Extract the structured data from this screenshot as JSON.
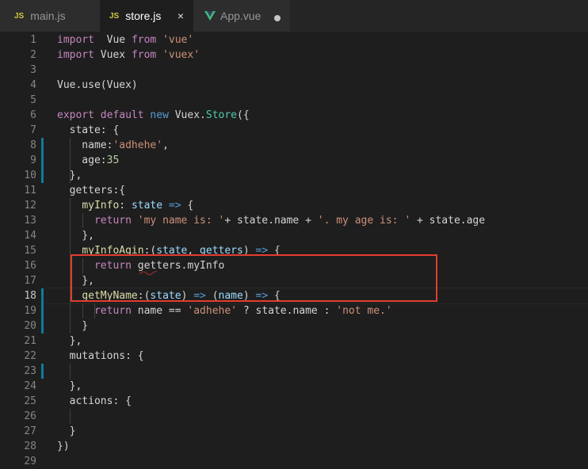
{
  "tabs": [
    {
      "label": "main.js",
      "icon": "JS",
      "active": false
    },
    {
      "label": "store.js",
      "icon": "JS",
      "active": true,
      "close": "×"
    },
    {
      "label": "App.vue",
      "icon": "vue-icon",
      "active": false,
      "modified": true
    }
  ],
  "colors": {
    "keyword": "#569cd6",
    "control": "#c586c0",
    "string": "#ce9178",
    "number": "#b5cea8",
    "property": "#9cdcfe",
    "class": "#4ec9b0",
    "highlight_box": "#e33d2f",
    "git_bar": "#0c7d9d"
  },
  "current_line": 18,
  "lines": [
    {
      "n": "1",
      "t": [
        [
          "ctl",
          "import"
        ],
        [
          "",
          "  Vue "
        ],
        [
          "ctl",
          "from"
        ],
        [
          "",
          ""
        ],
        [
          "str",
          " 'vue'"
        ]
      ]
    },
    {
      "n": "2",
      "t": [
        [
          "ctl",
          "import"
        ],
        [
          "",
          " Vuex "
        ],
        [
          "ctl",
          "from"
        ],
        [
          "str",
          " 'vuex'"
        ]
      ]
    },
    {
      "n": "3",
      "t": []
    },
    {
      "n": "4",
      "t": [
        [
          "",
          "Vue"
        ],
        [
          "",
          ".use(Vuex)"
        ]
      ]
    },
    {
      "n": "5",
      "t": []
    },
    {
      "n": "6",
      "t": [
        [
          "ctl",
          "export"
        ],
        [
          "",
          " "
        ],
        [
          "ctl",
          "default"
        ],
        [
          "",
          " "
        ],
        [
          "kw",
          "new"
        ],
        [
          "",
          " Vuex."
        ],
        [
          "cls",
          "Store"
        ],
        [
          "",
          "({"
        ]
      ]
    },
    {
      "n": "7",
      "t": [
        [
          "",
          "  state: {"
        ]
      ]
    },
    {
      "n": "8",
      "t": [
        [
          "",
          "    name:"
        ],
        [
          "str",
          "'adhehe'"
        ],
        [
          "",
          ","
        ]
      ]
    },
    {
      "n": "9",
      "t": [
        [
          "",
          "    age:"
        ],
        [
          "num",
          "35"
        ]
      ]
    },
    {
      "n": "10",
      "t": [
        [
          "",
          "  },"
        ]
      ]
    },
    {
      "n": "11",
      "t": [
        [
          "",
          "  getters:{"
        ]
      ]
    },
    {
      "n": "12",
      "t": [
        [
          "",
          "    "
        ],
        [
          "fn",
          "myInfo"
        ],
        [
          "",
          ": "
        ],
        [
          "prop",
          "state"
        ],
        [
          "",
          " "
        ],
        [
          "kw",
          "=>"
        ],
        [
          "",
          " {"
        ]
      ]
    },
    {
      "n": "13",
      "t": [
        [
          "",
          "      "
        ],
        [
          "ctl",
          "return"
        ],
        [
          "",
          " "
        ],
        [
          "str",
          "'my name is: '"
        ],
        [
          "",
          "+ state.name + "
        ],
        [
          "str",
          "'. my age is: '"
        ],
        [
          "",
          " + state.age"
        ]
      ]
    },
    {
      "n": "14",
      "t": [
        [
          "",
          "    },"
        ]
      ]
    },
    {
      "n": "15",
      "t": [
        [
          "",
          "    "
        ],
        [
          "fn",
          "myInfoAgin"
        ],
        [
          "",
          ":("
        ],
        [
          "prop",
          "state"
        ],
        [
          "",
          ", "
        ],
        [
          "prop",
          "getters"
        ],
        [
          "",
          ") "
        ],
        [
          "kw",
          "=>"
        ],
        [
          "",
          " {"
        ]
      ]
    },
    {
      "n": "16",
      "t": [
        [
          "",
          "      "
        ],
        [
          "ctl",
          "return"
        ],
        [
          "",
          " getters.myInfo"
        ]
      ]
    },
    {
      "n": "17",
      "t": [
        [
          "",
          "    },"
        ]
      ]
    },
    {
      "n": "18",
      "t": [
        [
          "",
          "    "
        ],
        [
          "fn",
          "getMyName"
        ],
        [
          "",
          ":("
        ],
        [
          "prop",
          "state"
        ],
        [
          "",
          ") "
        ],
        [
          "kw",
          "=>"
        ],
        [
          "",
          " ("
        ],
        [
          "prop",
          "name"
        ],
        [
          "",
          ") "
        ],
        [
          "kw",
          "=>"
        ],
        [
          "",
          " {"
        ]
      ]
    },
    {
      "n": "19",
      "t": [
        [
          "",
          "      "
        ],
        [
          "ctl",
          "return"
        ],
        [
          "",
          " name == "
        ],
        [
          "str",
          "'adhehe'"
        ],
        [
          "",
          " ? state.name : "
        ],
        [
          "str",
          "'not me.'"
        ]
      ]
    },
    {
      "n": "20",
      "t": [
        [
          "",
          "    }"
        ]
      ]
    },
    {
      "n": "21",
      "t": [
        [
          "",
          "  },"
        ]
      ]
    },
    {
      "n": "22",
      "t": [
        [
          "",
          "  mutations: {"
        ]
      ]
    },
    {
      "n": "23",
      "t": []
    },
    {
      "n": "24",
      "t": [
        [
          "",
          "  },"
        ]
      ]
    },
    {
      "n": "25",
      "t": [
        [
          "",
          "  actions: {"
        ]
      ]
    },
    {
      "n": "26",
      "t": []
    },
    {
      "n": "27",
      "t": [
        [
          "",
          "  }"
        ]
      ]
    },
    {
      "n": "28",
      "t": [
        [
          "",
          "})"
        ]
      ]
    },
    {
      "n": "29",
      "t": []
    }
  ]
}
